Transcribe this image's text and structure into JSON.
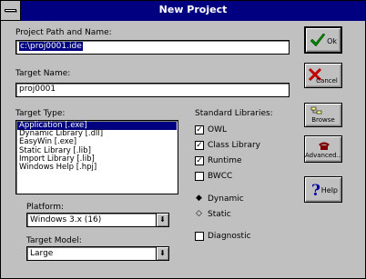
{
  "window": {
    "title": "New Project"
  },
  "project_path": {
    "label": "Project Path and Name:",
    "value": "c:\\proj0001.ide"
  },
  "target_name": {
    "label": "Target Name:",
    "value": "proj0001"
  },
  "target_type": {
    "label": "Target Type:",
    "items": [
      "Application [.exe]",
      "Dynamic Library [.dll]",
      "EasyWin [.exe]",
      "Static Library [.lib]",
      "Import Library [.lib]",
      "Windows Help [.hpj]"
    ],
    "selected_index": 0
  },
  "platform": {
    "label": "Platform:",
    "value": "Windows 3.x (16)"
  },
  "target_model": {
    "label": "Target Model:",
    "value": "Large"
  },
  "standard_libraries": {
    "label": "Standard Libraries:",
    "options": [
      {
        "label": "OWL",
        "checked": true
      },
      {
        "label": "Class Library",
        "checked": true
      },
      {
        "label": "Runtime",
        "checked": true
      },
      {
        "label": "BWCC",
        "checked": false
      }
    ]
  },
  "linking": {
    "options": [
      {
        "label": "Dynamic",
        "selected": true
      },
      {
        "label": "Static",
        "selected": false
      }
    ]
  },
  "diagnostic": {
    "label": "Diagnostic",
    "checked": false
  },
  "buttons": {
    "ok": "Ok",
    "cancel": "Cancel",
    "browse": "Browse",
    "advanced": "Advanced...",
    "help": "Help"
  }
}
